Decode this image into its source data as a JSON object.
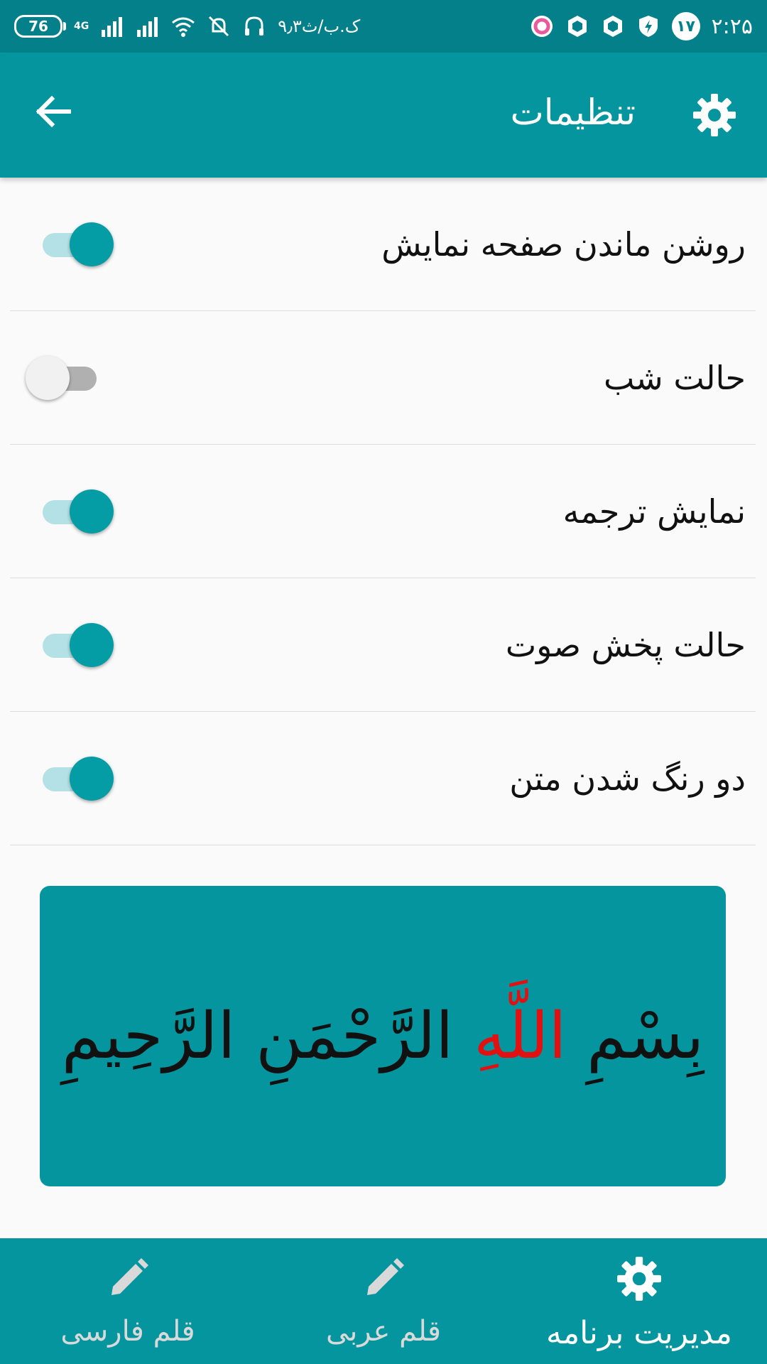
{
  "status_bar": {
    "battery": "76",
    "network": "4G",
    "carrier_time": "۹٫۳ک.ب/ث",
    "notification_badge": "۱۷",
    "clock": "۲:۲۵"
  },
  "app_bar": {
    "title": "تنظیمات",
    "back_icon": "arrow-left-icon",
    "settings_icon": "gear-icon"
  },
  "settings": [
    {
      "label": "روشن ماندن صفحه نمایش",
      "on": true
    },
    {
      "label": "حالت شب",
      "on": false
    },
    {
      "label": "نمایش ترجمه",
      "on": true
    },
    {
      "label": "حالت پخش صوت",
      "on": true
    },
    {
      "label": "دو رنگ شدن متن",
      "on": true
    }
  ],
  "preview": {
    "part1": "بِسْمِ",
    "part2": "اللَّهِ",
    "part3": "الرَّحْمَنِ الرَّحِيمِ"
  },
  "bottom_nav": [
    {
      "label": "قلم فارسی",
      "icon": "pencil-icon",
      "active": false
    },
    {
      "label": "قلم عربی",
      "icon": "pencil-icon",
      "active": false
    },
    {
      "label": "مدیریت برنامه",
      "icon": "gear-icon",
      "active": true
    }
  ],
  "colors": {
    "primary": "#04959e",
    "status_bar": "#04808a",
    "toggle_on": "#049da6",
    "accent_text": "#e21010"
  }
}
